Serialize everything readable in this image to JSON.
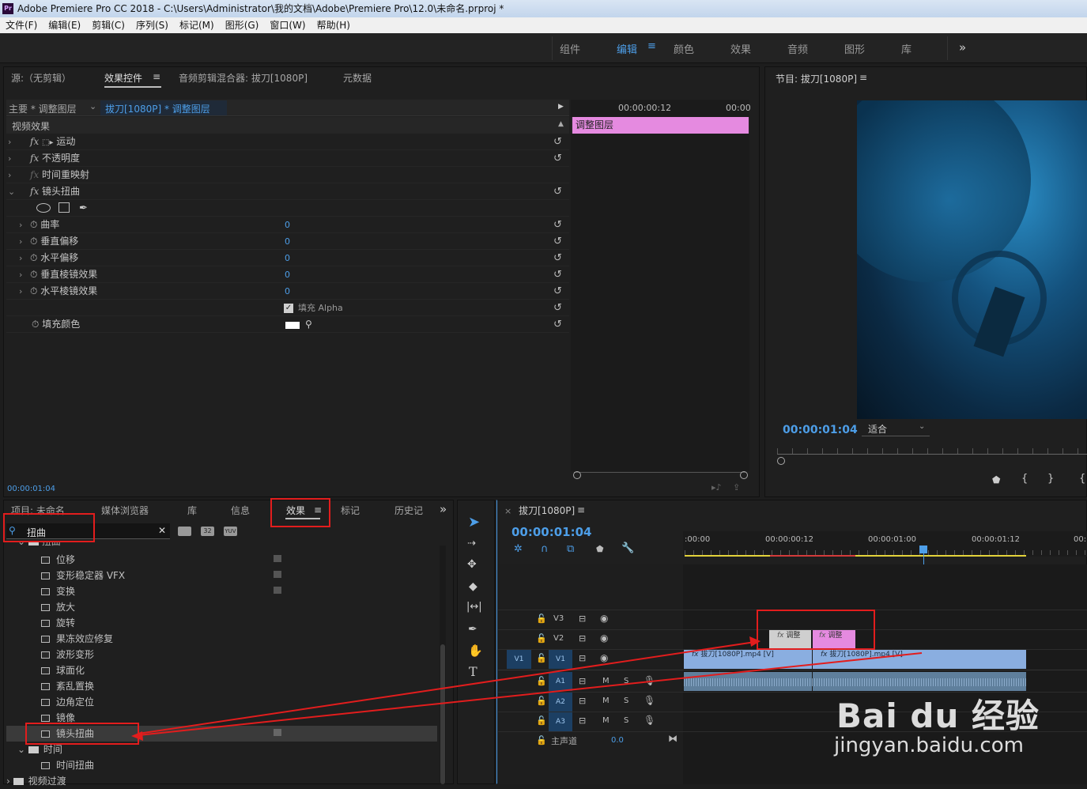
{
  "window": {
    "app_logo": "Pr",
    "title": "Adobe Premiere Pro CC 2018 - C:\\Users\\Administrator\\我的文档\\Adobe\\Premiere Pro\\12.0\\未命名.prproj *"
  },
  "menu": [
    "文件(F)",
    "编辑(E)",
    "剪辑(C)",
    "序列(S)",
    "标记(M)",
    "图形(G)",
    "窗口(W)",
    "帮助(H)"
  ],
  "workspaces": [
    "组件",
    "编辑",
    "颜色",
    "效果",
    "音频",
    "图形",
    "库"
  ],
  "active_workspace": "编辑",
  "source_tabs": {
    "source": "源:（无剪辑）",
    "effect_controls": "效果控件",
    "audio_mixer": "音频剪辑混合器: 拔刀[1080P]",
    "metadata": "元数据"
  },
  "ec": {
    "master": "主要 * 调整图层",
    "clip": "拔刀[1080P] * 调整图层",
    "timecode_a": "00:00:00:12",
    "timecode_b": "00:00",
    "clip_bar": "调整图层",
    "section": "视频效果",
    "effects": [
      {
        "name": "运动"
      },
      {
        "name": "不透明度"
      },
      {
        "name": "时间重映射"
      },
      {
        "name": "镜头扭曲"
      }
    ],
    "params": [
      {
        "name": "曲率",
        "value": "0"
      },
      {
        "name": "垂直偏移",
        "value": "0"
      },
      {
        "name": "水平偏移",
        "value": "0"
      },
      {
        "name": "垂直棱镜效果",
        "value": "0"
      },
      {
        "name": "水平棱镜效果",
        "value": "0"
      }
    ],
    "fill_alpha": "填充 Alpha",
    "fill_color": "填充颜色",
    "current_time": "00:00:01:04"
  },
  "program": {
    "title": "节目: 拔刀[1080P]",
    "timecode": "00:00:01:04",
    "fit": "适合"
  },
  "project_tabs": [
    "项目: 未命名",
    "媒体浏览器",
    "库",
    "信息",
    "效果",
    "标记",
    "历史记录"
  ],
  "effects_panel": {
    "search_value": "扭曲",
    "badges": [
      "32",
      "YUV"
    ],
    "partial_folder": "扭曲",
    "items": [
      "位移",
      "变形稳定器 VFX",
      "变换",
      "放大",
      "旋转",
      "果冻效应修复",
      "波形变形",
      "球面化",
      "紊乱置换",
      "边角定位",
      "镜像",
      "镜头扭曲"
    ],
    "time_folder": "时间",
    "time_items": [
      "时间扭曲"
    ],
    "video_transitions": "视频过渡"
  },
  "timeline": {
    "title": "拔刀[1080P]",
    "timecode": "00:00:01:04",
    "ruler": [
      ":00:00",
      "00:00:00:12",
      "00:00:01:00",
      "00:00:01:12",
      "00:"
    ],
    "video_tracks": [
      "V3",
      "V2",
      "V1"
    ],
    "audio_tracks": [
      "A1",
      "A2",
      "A3"
    ],
    "source_patch": "V1",
    "master_label": "主声道",
    "master_value": "0.0",
    "adj_clip": "调整",
    "clip1": "拔刀[1080P].mp4 [V]",
    "clip2": "拔刀[1080P].mp4 [V]"
  },
  "watermark": {
    "brand": "Bai du 经验",
    "url": "jingyan.baidu.com"
  }
}
